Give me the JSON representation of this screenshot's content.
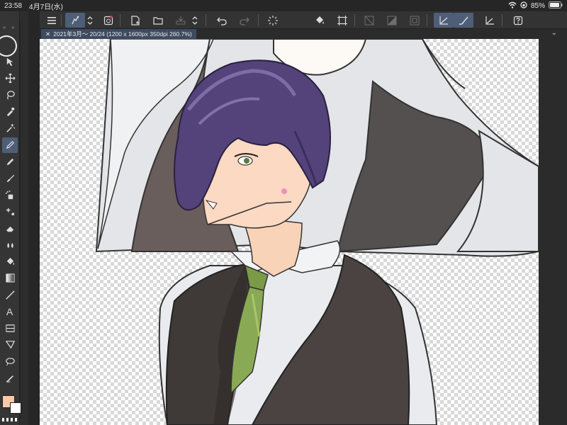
{
  "status": {
    "time": "23:58",
    "date": "4月7日(水)",
    "battery": "85%"
  },
  "document": {
    "tab_label": "2021年3月〜 20/24 (1200 x 1600px 350dpi 260.7%)"
  },
  "colors": {
    "main": "#f8c8a8",
    "sub": "#ffffff",
    "accent": "#4f5e78"
  },
  "commands": [
    {
      "name": "menu-icon"
    },
    {
      "name": "touch-gesture-icon"
    },
    {
      "name": "stepper-icon"
    },
    {
      "name": "quick-access-icon"
    },
    {
      "name": "new-file-icon"
    },
    {
      "name": "open-file-icon"
    },
    {
      "name": "save-icon"
    },
    {
      "name": "undo-icon"
    },
    {
      "name": "redo-icon"
    },
    {
      "name": "clear-layer-icon"
    },
    {
      "name": "fill-icon"
    },
    {
      "name": "transform-icon"
    },
    {
      "name": "snap-ruler-icon"
    },
    {
      "name": "snap-special-ruler-icon"
    },
    {
      "name": "snap-grid-icon"
    },
    {
      "name": "stabilization-icon"
    },
    {
      "name": "brush-settings-icon"
    },
    {
      "name": "ruler-icon"
    },
    {
      "name": "help-icon"
    }
  ],
  "tools": [
    {
      "name": "select-move-icon"
    },
    {
      "name": "move-icon"
    },
    {
      "name": "lasso-icon"
    },
    {
      "name": "eyedropper-icon"
    },
    {
      "name": "magic-wand-icon"
    },
    {
      "name": "pen-icon"
    },
    {
      "name": "pencil-icon"
    },
    {
      "name": "brush-icon"
    },
    {
      "name": "airbrush-icon"
    },
    {
      "name": "decoration-icon"
    },
    {
      "name": "eraser-icon"
    },
    {
      "name": "blend-icon"
    },
    {
      "name": "fill-tool-icon"
    },
    {
      "name": "gradient-icon"
    },
    {
      "name": "line-icon"
    },
    {
      "name": "text-icon"
    },
    {
      "name": "frame-icon"
    },
    {
      "name": "balloon-icon"
    },
    {
      "name": "ruler-tool-icon"
    },
    {
      "name": "correct-line-icon"
    }
  ]
}
